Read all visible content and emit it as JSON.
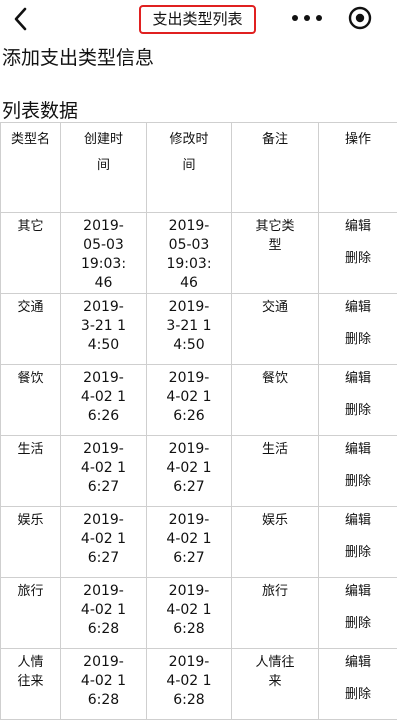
{
  "nav": {
    "title": "支出类型列表",
    "icons": [
      "back-arrow-icon",
      "more-dots-icon",
      "target-record-icon"
    ]
  },
  "add_link": "添加支出类型信息",
  "section_title": "列表数据",
  "table": {
    "headers": [
      "类型名",
      "创建时间",
      "修改时间",
      "备注",
      "操作"
    ],
    "rows": [
      {
        "name": "其它",
        "created": "2019-05-03 19:03:46",
        "modified": "2019-05-03 19:03:46",
        "note": "其它类型",
        "edit": "编辑",
        "delete": "删除"
      },
      {
        "name": "交通",
        "created": "2019-3-21 14:50",
        "modified": "2019-3-21 14:50",
        "note": "交通",
        "edit": "编辑",
        "delete": "删除"
      },
      {
        "name": "餐饮",
        "created": "2019-4-02 16:26",
        "modified": "2019-4-02 16:26",
        "note": "餐饮",
        "edit": "编辑",
        "delete": "删除"
      },
      {
        "name": "生活",
        "created": "2019-4-02 16:27",
        "modified": "2019-4-02 16:27",
        "note": "生活",
        "edit": "编辑",
        "delete": "删除"
      },
      {
        "name": "娱乐",
        "created": "2019-4-02 16:27",
        "modified": "2019-4-02 16:27",
        "note": "娱乐",
        "edit": "编辑",
        "delete": "删除"
      },
      {
        "name": "旅行",
        "created": "2019-4-02 16:28",
        "modified": "2019-4-02 16:28",
        "note": "旅行",
        "edit": "编辑",
        "delete": "删除"
      },
      {
        "name": "人情往来",
        "created": "2019-4-02 16:28",
        "modified": "2019-4-02 16:28",
        "note": "人情往来",
        "edit": "编辑",
        "delete": "删除"
      }
    ]
  }
}
